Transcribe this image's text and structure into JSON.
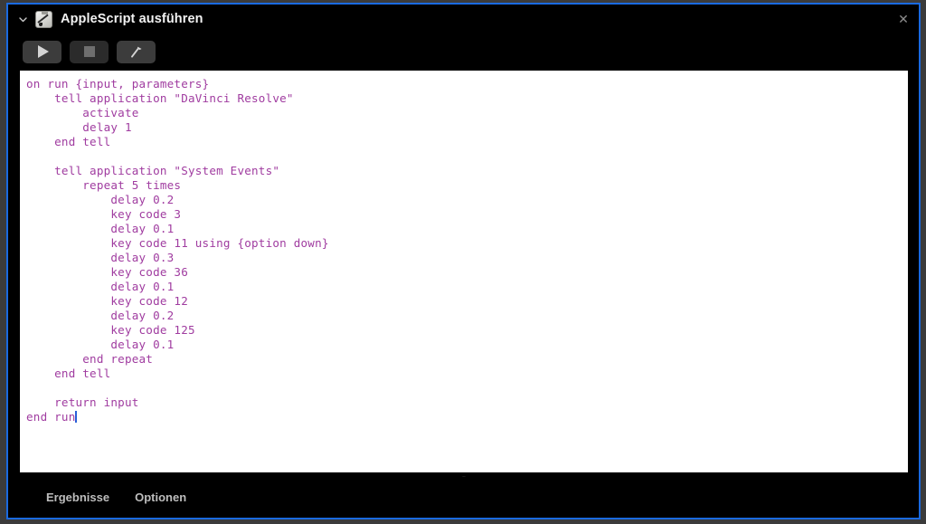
{
  "window": {
    "title": "AppleScript ausführen",
    "app_icon": "applescript-icon",
    "disclosure_icon": "chevron-down-icon",
    "close_icon": "close-icon",
    "border_color": "#1a6ae0",
    "background_color": "#000000"
  },
  "toolbar": {
    "buttons": [
      {
        "name": "run-button",
        "icon": "play-icon",
        "enabled": true
      },
      {
        "name": "stop-button",
        "icon": "stop-icon",
        "enabled": false
      },
      {
        "name": "compile-button",
        "icon": "hammer-icon",
        "enabled": true
      }
    ]
  },
  "editor": {
    "background_color": "#ffffff",
    "text_color": "#a03ca0",
    "caret_color": "#2a5fd8",
    "code": "on run {input, parameters}\n    tell application \"DaVinci Resolve\"\n        activate\n        delay 1\n    end tell\n\n    tell application \"System Events\"\n        repeat 5 times\n            delay 0.2\n            key code 3\n            delay 0.1\n            key code 11 using {option down}\n            delay 0.3\n            key code 36\n            delay 0.1\n            key code 12\n            delay 0.2\n            key code 125\n            delay 0.1\n        end repeat\n    end tell\n\n    return input\nend run"
  },
  "resize_grip": {
    "name": "resize-grip"
  },
  "bottom_bar": {
    "tabs": [
      {
        "name": "results-tab",
        "label": "Ergebnisse"
      },
      {
        "name": "options-tab",
        "label": "Optionen"
      }
    ]
  }
}
